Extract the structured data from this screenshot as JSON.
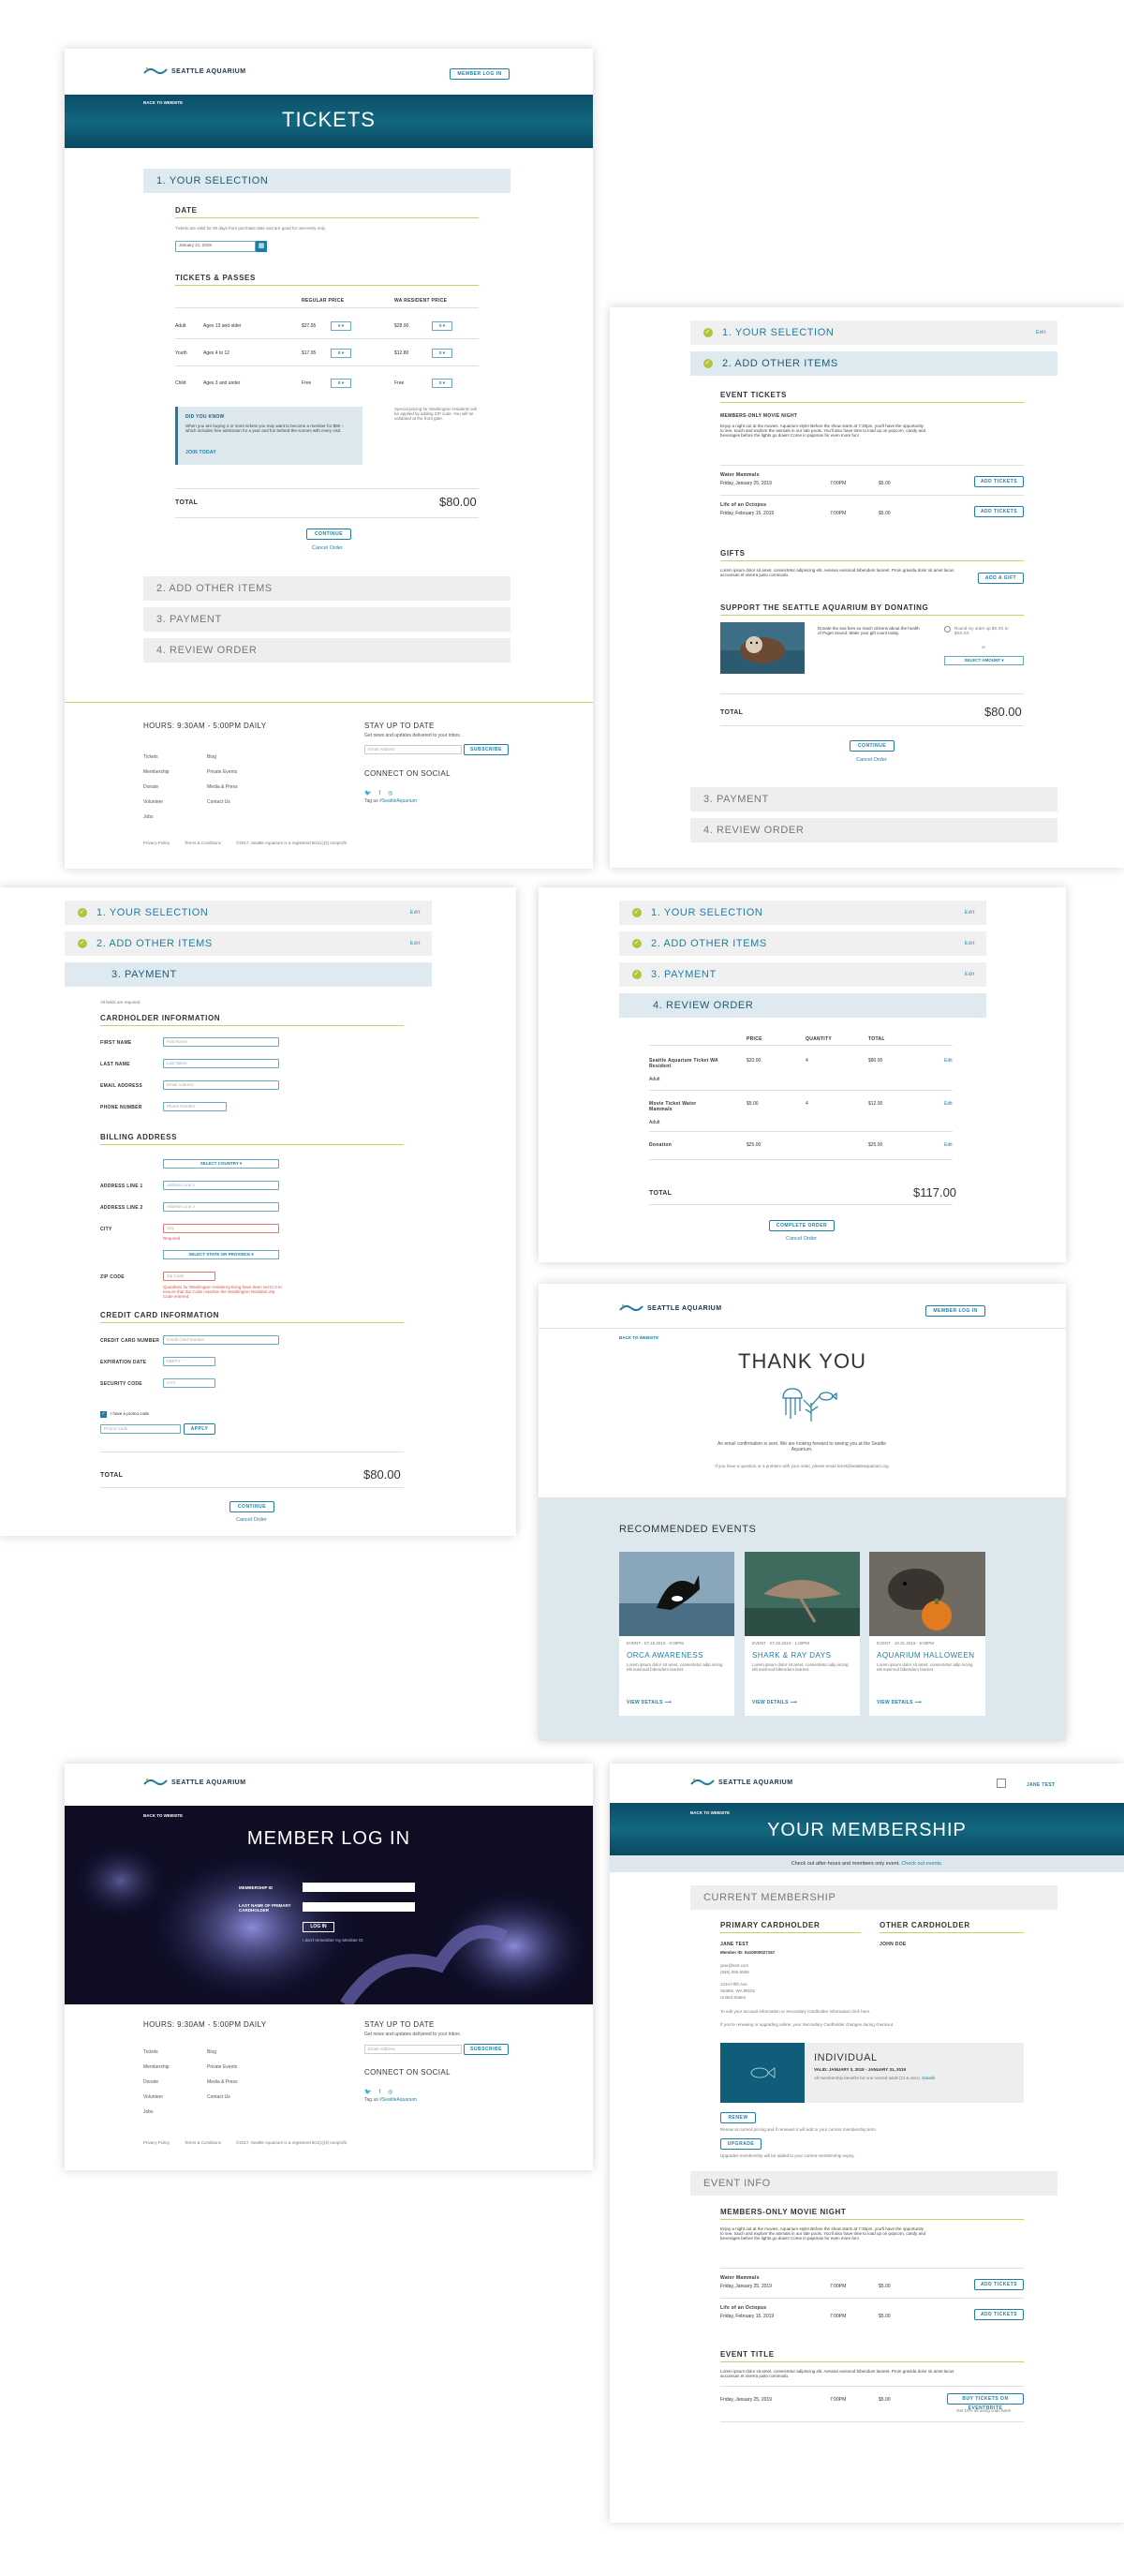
{
  "brand": {
    "name": "SEATTLE AQUARIUM",
    "accent": "#1d7ea5",
    "olive": "#b4c43a",
    "hero": "#0f5d78"
  },
  "common": {
    "member_login": "MEMBER LOG IN",
    "back_to_website": "BACK TO WEBSITE",
    "continue": "CONTINUE",
    "cancel_order": "Cancel Order",
    "edit": "Edit",
    "total": "TOTAL"
  },
  "steps": {
    "s1": "1. YOUR SELECTION",
    "s2": "2. ADD OTHER ITEMS",
    "s3": "3. PAYMENT",
    "s4": "4. REVIEW ORDER"
  },
  "tickets_page": {
    "title": "TICKETS",
    "date_heading": "DATE",
    "date_note": "Tickets are valid for 90 days from purchase date and are good for one-entry only.",
    "date_value": "January 21, 2019",
    "passes_heading": "TICKETS & PASSES",
    "col_regular": "REGULAR PRICE",
    "col_resident": "WA RESIDENT PRICE",
    "rows": [
      {
        "type": "Adult",
        "age": "Ages 13 and older",
        "regular": "$37.95",
        "resident": "$28.00"
      },
      {
        "type": "Youth",
        "age": "Ages 4 to 12",
        "regular": "$17.95",
        "resident": "$12.80"
      },
      {
        "type": "Child",
        "age": "Ages 3 and under",
        "regular": "Free",
        "resident": "Free"
      }
    ],
    "qty": "0",
    "dyk_title": "DID YOU KNOW",
    "dyk_text": "When you are buying 4 or more tickets you may want to become a member for $90 – which includes free admission for a year and fun behind-the-scenes with every visit.",
    "dyk_link": "JOIN TODAY",
    "side_note": "Special pricing for Washington residents will be applied by adding ZIP code. You will be validated at the front gate.",
    "total": "$80.00"
  },
  "footer": {
    "hours": "HOURS: 9:30AM - 5:00PM DAILY",
    "links_a": [
      "Tickets",
      "Membership",
      "Donate",
      "Volunteer",
      "Jobs"
    ],
    "links_b": [
      "Blog",
      "Private Events",
      "Media & Press",
      "Contact Us"
    ],
    "stay_title": "STAY UP TO DATE",
    "stay_sub": "Get news and updates delivered to your inbox.",
    "email_placeholder": "Email Address",
    "subscribe": "SUBSCRIBE",
    "social_title": "CONNECT ON SOCIAL",
    "tag_prefix": "Tag us",
    "tag_handle": "#SeattleAquarium",
    "privacy": "Privacy Policy",
    "terms": "Terms & Conditions",
    "copyright": "©2017, Seattle Aquarium is a registered 501(c)(3) nonprofit"
  },
  "add_items_page": {
    "event_tickets": "EVENT TICKETS",
    "movie_title": "MEMBERS-ONLY MOVIE NIGHT",
    "movie_text": "Enjoy a night out at the movies. Aquarium-style! Before the show starts at 7:30pm, you'll have the opportunity to see, touch and explore the animals in our tide pools. You'll also have time to load up on popcorn, candy and beverages before the lights go down! Come in pajamas for even more fun!",
    "events": [
      {
        "name": "Water Mammals",
        "date": "Friday, January 25, 2019",
        "time": "7:00PM",
        "price": "$5.00"
      },
      {
        "name": "Life of an Octopus",
        "date": "Friday, February 15, 2019",
        "time": "7:00PM",
        "price": "$5.00"
      }
    ],
    "add_tickets": "ADD TICKETS",
    "gifts": "GIFTS",
    "gifts_text": "Lorem ipsum dolor sit amet, consectetur adipiscing elit. Aenean euismod bibendum laoreet. Proin gravida dolor sit amet lacus accumsan et viverra justo commodo.",
    "add_gift": "ADD A GIFT",
    "donate_title": "SUPPORT THE SEATTLE AQUARIUM BY DONATING",
    "donate_text": "Donate the sea fees so reach citizens about the health of Puget Sound. Make your gift count today.",
    "round_up": "Round my order up $X.XX to $XX.XX",
    "or": "or",
    "select_amount": "SELECT AMOUNT",
    "total": "$80.00"
  },
  "payment_page": {
    "required": "All fields are required.",
    "cardholder": "CARDHOLDER INFORMATION",
    "fields_card": [
      {
        "label": "FIRST NAME",
        "ph": "First Name"
      },
      {
        "label": "LAST NAME",
        "ph": "Last Name"
      },
      {
        "label": "EMAIL ADDRESS",
        "ph": "Email Address"
      },
      {
        "label": "PHONE NUMBER",
        "ph": "Phone Number"
      }
    ],
    "billing": "BILLING ADDRESS",
    "select_country": "SELECT COUNTRY",
    "fields_bill": [
      {
        "label": "ADDRESS LINE 1",
        "ph": "Address Line 1"
      },
      {
        "label": "ADDRESS LINE 2",
        "ph": "Address Line 2"
      },
      {
        "label": "CITY",
        "ph": "City"
      }
    ],
    "required_err": "Required",
    "select_state": "SELECT STATE OR PROVINCE",
    "zip_label": "ZIP CODE",
    "zip_ph": "Zip Code",
    "zip_err": "Quantities for Washington resident pricing have been set to 0 to ensure that Zip Code matches the Washington Resident Zip Code entered.",
    "credit": "CREDIT CARD INFORMATION",
    "fields_cc": [
      {
        "label": "CREDIT CARD NUMBER",
        "ph": "Credit Card Number"
      },
      {
        "label": "EXPIRATION DATE",
        "ph": "MM/YY"
      },
      {
        "label": "SECURITY CODE",
        "ph": "CVV"
      }
    ],
    "promo_check": "I have a promo code",
    "promo_ph": "Promo Code",
    "apply": "APPLY",
    "total": "$80.00"
  },
  "review_page": {
    "col_item": "ITEM",
    "col_price": "PRICE",
    "col_qty": "QUANTITY",
    "col_total": "TOTAL",
    "rows": [
      {
        "name": "Seattle Aquarium Ticket WA Resident",
        "sub": "Adult",
        "price": "$20.00",
        "qty": "4",
        "total": "$80.00"
      },
      {
        "name": "Movie Ticket Water Mammals",
        "sub": "Adult",
        "price": "$5.00",
        "qty": "4",
        "total": "$12.00"
      },
      {
        "name": "Donation",
        "sub": "",
        "price": "$25.00",
        "qty": "",
        "total": "$25.00"
      }
    ],
    "total": "$117.00",
    "complete": "COMPLETE ORDER"
  },
  "thanks_page": {
    "title": "THANK YOU",
    "msg": "An email confirmation is sent. We are looking forward to seeing you at the Seattle Aquarium.",
    "note": "If you have a question or a problem with your order, please email ticket@seattleaquarium.org",
    "recommended": "RECOMMENDED EVENTS",
    "events": [
      {
        "tags": "EVENT · 07.15.2019 · 6:00PM",
        "name": "ORCA AWARENESS",
        "text": "Lorem ipsum dolor sit amet, consectetur adip iscing elit euismod bibendum laoreet."
      },
      {
        "tags": "EVENT · 07.20.2019 · 1:00PM",
        "name": "SHARK & RAY DAYS",
        "text": "Lorem ipsum dolor sit amet, consectetur adip iscing elit euismod bibendum laoreet."
      },
      {
        "tags": "EVENT · 10.31.2019 · 5:00PM",
        "name": "AQUARIUM HALLOWEEN",
        "text": "Lorem ipsum dolor sit amet, consectetur adip iscing elit euismod bibendum laoreet."
      }
    ],
    "view_details": "VIEW DETAILS"
  },
  "login_page": {
    "title": "MEMBER LOG IN",
    "membership_id": "MEMBERSHIP ID",
    "last_name": "LAST NAME OF PRIMARY CARDHOLDER",
    "login": "LOG IN",
    "forgot": "I don't remember my Member ID"
  },
  "membership_page": {
    "user": "JANE TEST",
    "title": "YOUR MEMBERSHIP",
    "banner": "Check out after-hours and members only event.",
    "banner_link": "Check out events.",
    "current": "CURRENT MEMBERSHIP",
    "primary": "PRIMARY CARDHOLDER",
    "other": "OTHER CARDHOLDER",
    "primary_name": "JANE TEST",
    "member_id": "Member ID: 0410000027167",
    "contact": "jane@test.com",
    "phone": "(555) 555-5555",
    "addr1": "1234 Fifth Ave",
    "addr2": "Seattle, WA 98101",
    "addr3": "United States",
    "other_name": "JOHN DOE",
    "update_note": "To edit your account information or Secondary Cardholder information click here.",
    "upgrade_note": "If you're renewing or upgrading online, your Secondary Cardholder changes during checkout.",
    "plan": "INDIVIDUAL",
    "valid": "VALID: JANUARY 3, 2018 - JANUARY 31, 2019",
    "benefit": "All membership benefits for one named adult (13 & over).",
    "details": "Details",
    "renew": "RENEW",
    "renew_note": "Renew at current pricing and if renewed it will add to your current membership term.",
    "upgrade": "UPGRADE",
    "upgrade_note2": "Upgrades membership will be added to your current membership expiry.",
    "event_info": "EVENT INFO",
    "movie_title": "MEMBERS-ONLY MOVIE NIGHT",
    "movie_text": "Enjoy a night out at the movies. Aquarium-style! Before the show starts at 7:30pm, you'll have the opportunity to see, touch and explore the animals in our tide pools. You'll also have time to load up on popcorn, candy and beverages before the lights go down! Come in pajamas for even more fun!",
    "events": [
      {
        "name": "Water Mammals",
        "date": "Friday, January 25, 2019",
        "time": "7:00PM",
        "price": "$5.00"
      },
      {
        "name": "Life of an Octopus",
        "date": "Friday, February 15, 2019",
        "time": "7:00PM",
        "price": "$5.00"
      }
    ],
    "add_tickets": "ADD TICKETS",
    "event_title": "EVENT TITLE",
    "event_text": "Lorem ipsum dolor sit amet, consectetur adipiscing elit. Aenean euismod bibendum laoreet. Proin gravida dolor sit amet lacus accumsan et viverra justo commodo.",
    "event_date": "Friday, January 25, 2019",
    "event_time": "7:00PM",
    "event_price": "$5.00",
    "buy_at_aquarium": "BUY TICKETS ON EVENTBRITE",
    "eventbrite_note": "Get 10% off using code here!"
  }
}
